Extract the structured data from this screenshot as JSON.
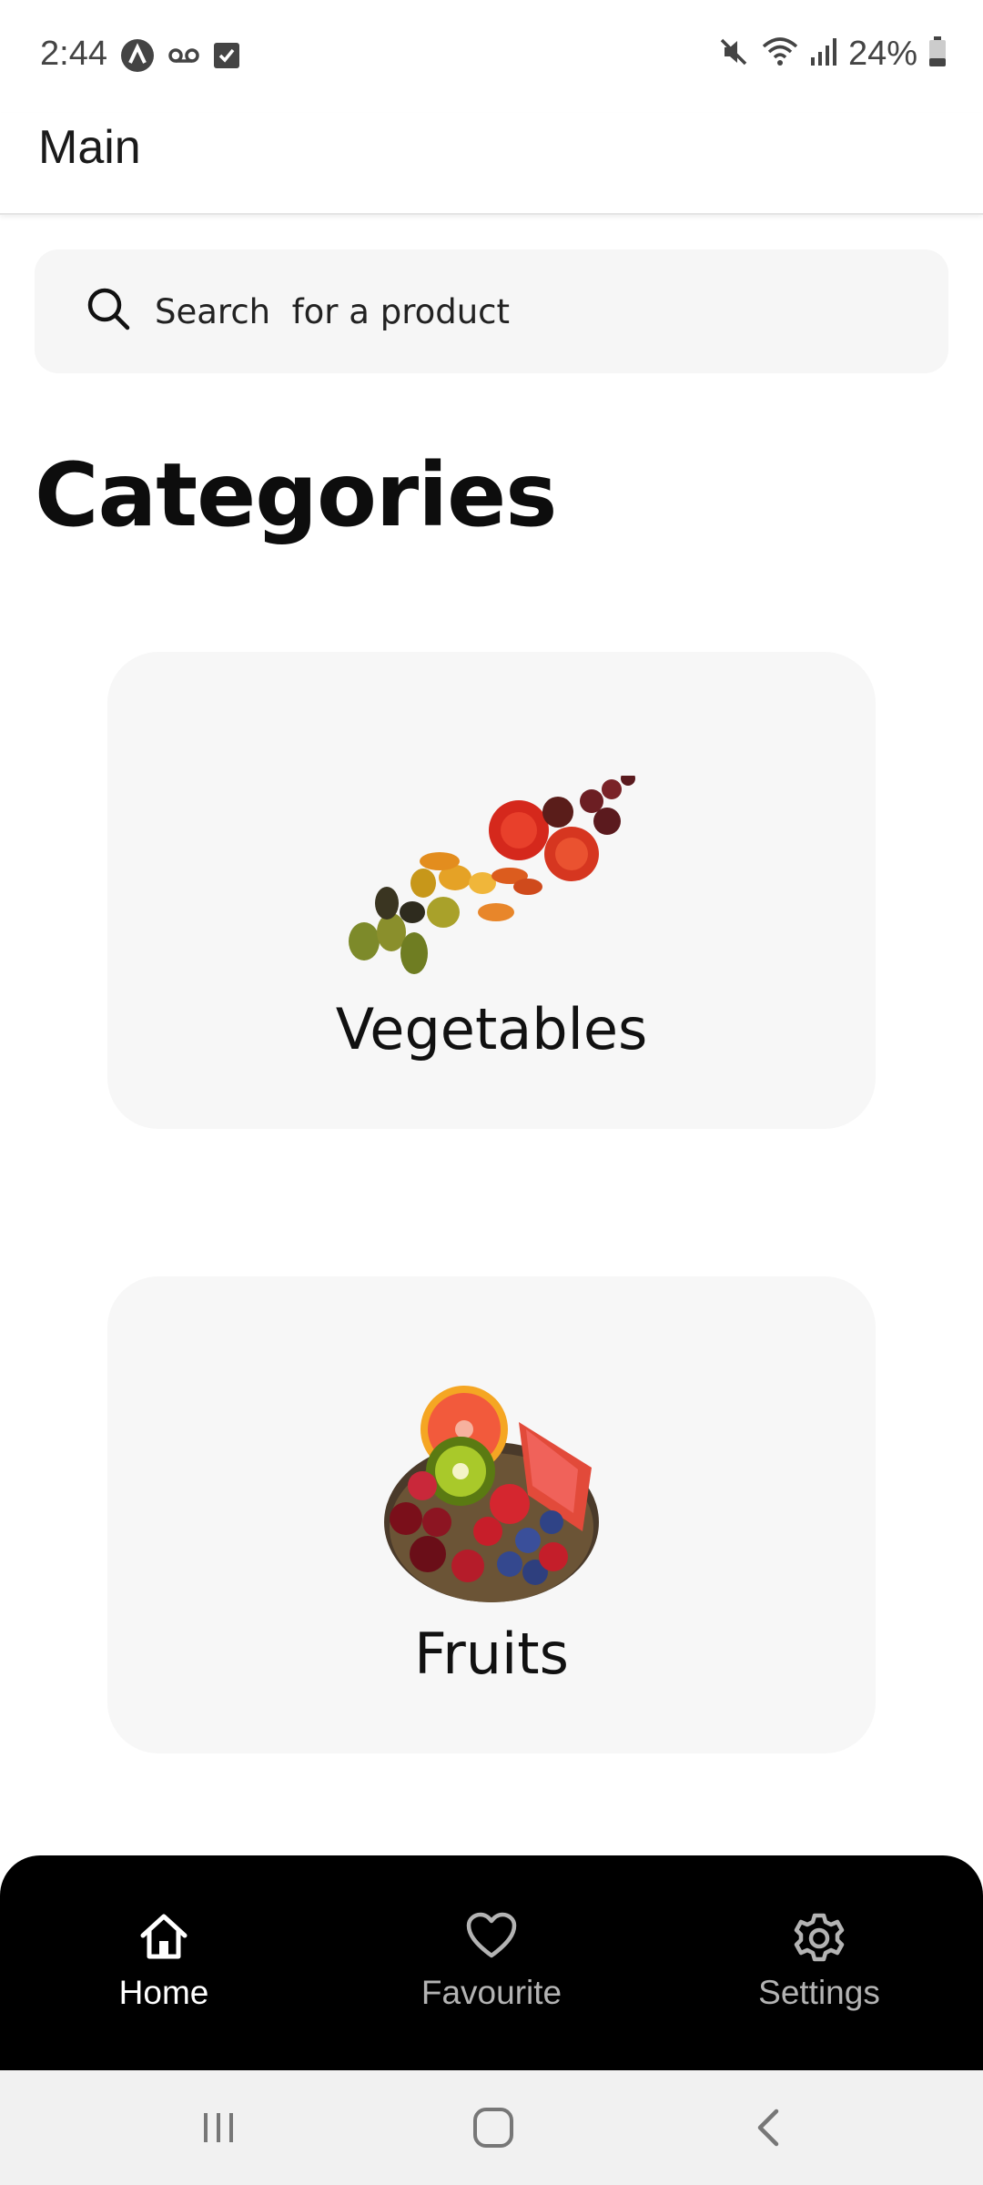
{
  "status_bar": {
    "time": "2:44",
    "battery": "24%",
    "icons": [
      "app-circle-icon",
      "voicemail-icon",
      "checkbox-icon",
      "mute-icon",
      "wifi-icon",
      "signal-icon",
      "battery-icon"
    ]
  },
  "app_bar": {
    "title": "Main"
  },
  "search": {
    "placeholder": "Search  for a product"
  },
  "main": {
    "section_title": "Categories",
    "categories": [
      {
        "label": "Vegetables",
        "icon": "vegetables-image"
      },
      {
        "label": "Fruits",
        "icon": "fruit-basket-image"
      }
    ]
  },
  "bottom_nav": {
    "items": [
      {
        "label": "Home",
        "icon": "home-icon",
        "active": true
      },
      {
        "label": "Favourite",
        "icon": "heart-icon",
        "active": false
      },
      {
        "label": "Settings",
        "icon": "gear-icon",
        "active": false
      }
    ],
    "active_color": "#ffffff",
    "inactive_color": "#b3b3b3"
  },
  "system_nav": {
    "icons": [
      "recents-icon",
      "home-pill-icon",
      "back-icon"
    ]
  },
  "colors": {
    "background": "#ffffff",
    "card": "#f7f7f7",
    "search_bg": "#f6f6f6",
    "nav_bg": "#000000"
  }
}
